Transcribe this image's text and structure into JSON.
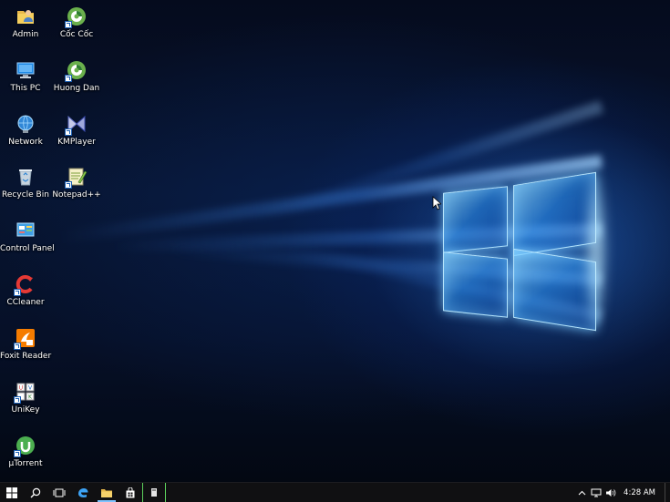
{
  "desktop": {
    "icons": [
      {
        "label": "Admin",
        "icon": "user-folder-icon"
      },
      {
        "label": "Cốc Cốc",
        "icon": "coccoc-browser-icon"
      },
      {
        "label": "This PC",
        "icon": "computer-icon"
      },
      {
        "label": "Huong Dan",
        "icon": "coccoc-browser-icon"
      },
      {
        "label": "Network",
        "icon": "network-globe-icon"
      },
      {
        "label": "KMPlayer",
        "icon": "kmplayer-icon"
      },
      {
        "label": "Recycle Bin",
        "icon": "recycle-bin-icon"
      },
      {
        "label": "Notepad++",
        "icon": "notepadpp-icon"
      },
      {
        "label": "Control Panel",
        "icon": "control-panel-icon"
      },
      {
        "label": "CCleaner",
        "icon": "ccleaner-icon"
      },
      {
        "label": "Foxit Reader",
        "icon": "foxit-reader-icon"
      },
      {
        "label": "UniKey",
        "icon": "unikey-icon"
      },
      {
        "label": "µTorrent",
        "icon": "utorrent-icon"
      }
    ]
  },
  "taskbar": {
    "buttons": [
      {
        "name": "start",
        "icon": "windows-logo-icon"
      },
      {
        "name": "search",
        "icon": "search-icon"
      },
      {
        "name": "task-view",
        "icon": "task-view-icon"
      },
      {
        "name": "edge",
        "icon": "edge-browser-icon"
      },
      {
        "name": "file-explorer",
        "icon": "folder-icon"
      },
      {
        "name": "store",
        "icon": "store-bag-icon"
      },
      {
        "name": "running-app",
        "icon": "app-window-icon"
      }
    ],
    "tray": {
      "icons": [
        "chevron-up-icon",
        "network-monitor-icon",
        "speaker-icon"
      ],
      "clock": "4:28 AM"
    }
  },
  "colors": {
    "accent": "#7ec3ff",
    "taskbar": "#101012",
    "wallpaper_glow": "#2878e6"
  }
}
